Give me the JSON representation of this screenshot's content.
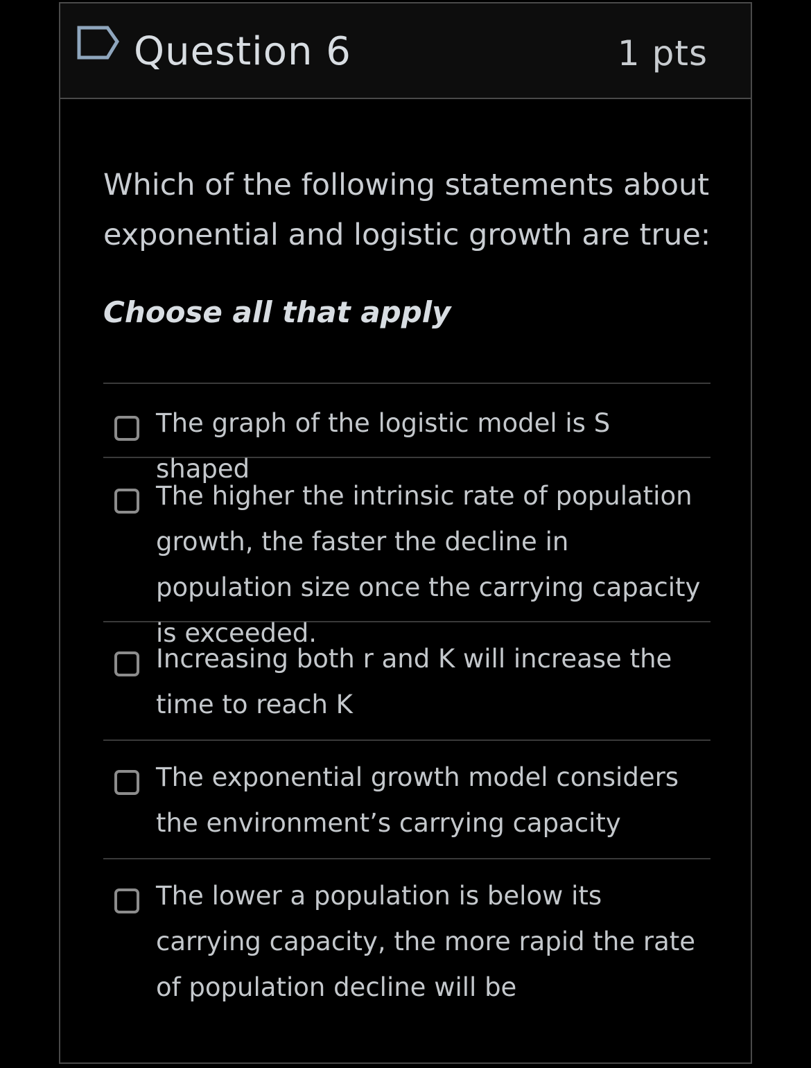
{
  "question": {
    "title": "Question 6",
    "points": "1 pts",
    "text": "Which of the following statements about exponential and logistic growth are true:",
    "instruction": "Choose all that apply",
    "flag_icon": "flag-outline-icon"
  },
  "answers": [
    {
      "label": "The graph of the logistic model is S shaped",
      "checked": false
    },
    {
      "label": "The higher the intrinsic rate of population growth, the faster the decline in population size once the carrying capacity is exceeded.",
      "checked": false
    },
    {
      "label": "Increasing both r and K will increase the time to reach K",
      "checked": false
    },
    {
      "label": "The exponential growth model considers the environment’s carrying capacity",
      "checked": false
    },
    {
      "label": "The lower a population is below its carrying capacity, the more rapid the rate of population decline will be",
      "checked": false
    }
  ],
  "colors": {
    "background": "#000000",
    "header_background": "#0d0d0d",
    "border": "#4a4a4a",
    "text": "#c9cdd2",
    "flag": "#8fa6bd"
  }
}
